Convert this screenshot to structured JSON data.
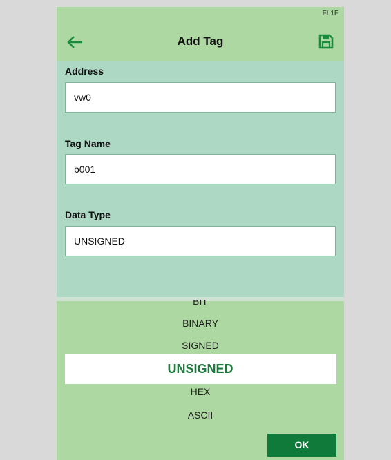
{
  "status": {
    "device_id": "FL1F"
  },
  "header": {
    "title": "Add Tag",
    "back_icon": "arrow-left-icon",
    "save_icon": "floppy-disk-icon",
    "accent": "#1e7a3c"
  },
  "form": {
    "address": {
      "label": "Address",
      "value": "vw0"
    },
    "tag_name": {
      "label": "Tag Name",
      "value": "b001"
    },
    "data_type": {
      "label": "Data Type",
      "value": "UNSIGNED"
    }
  },
  "picker": {
    "options": [
      "BIT",
      "BINARY",
      "SIGNED",
      "UNSIGNED",
      "HEX",
      "ASCII"
    ],
    "selected": "UNSIGNED",
    "ok_label": "OK"
  }
}
